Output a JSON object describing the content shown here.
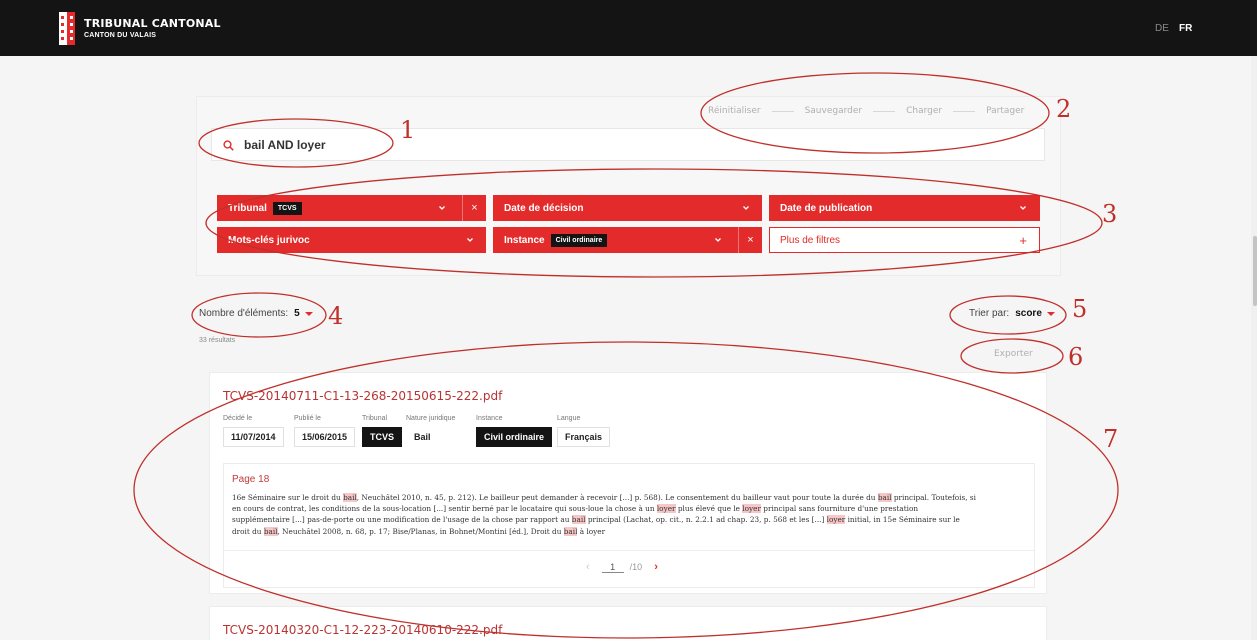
{
  "header": {
    "title": "TRIBUNAL CANTONAL",
    "subtitle": "CANTON DU VALAIS",
    "languages": [
      {
        "code": "DE",
        "active": false
      },
      {
        "code": "FR",
        "active": true
      }
    ]
  },
  "toolbar": {
    "reset_label": "Réinitialiser",
    "save_label": "Sauvegarder",
    "load_label": "Charger",
    "share_label": "Partager"
  },
  "search": {
    "value": "bail AND loyer",
    "icon": "search-icon"
  },
  "filters": {
    "tribunal": {
      "label": "Tribunal",
      "badge": "TCVS"
    },
    "decision_date": {
      "label": "Date de décision"
    },
    "publication_date": {
      "label": "Date de publication"
    },
    "keywords": {
      "label": "Mots-clés jurivoc"
    },
    "instance": {
      "label": "Instance",
      "badge": "Civil ordinaire"
    },
    "more": {
      "label": "Plus de filtres",
      "icon": "+"
    },
    "clear_symbol": "×"
  },
  "results": {
    "page_size_label": "Nombre d'éléments:",
    "page_size": "5",
    "total": "33 résultats",
    "sort_label": "Trier par:",
    "sort_value": "score",
    "export_label": "Exporter",
    "items": [
      {
        "title": "TCVS-20140711-C1-13-268-20150615-222.pdf",
        "meta": {
          "decided_label": "Décidé le",
          "decided": "11/07/2014",
          "published_label": "Publié le",
          "published": "15/06/2015",
          "tribunal_label": "Tribunal",
          "tribunal": "TCVS",
          "nature_label": "Nature juridique",
          "nature": "Bail",
          "instance_label": "Instance",
          "instance": "Civil ordinaire",
          "language_label": "Langue",
          "language": "Français"
        },
        "excerpt": {
          "page": "Page 18",
          "lines": [
            [
              {
                "t": "16e Séminaire sur le droit du "
              },
              {
                "t": "bail",
                "hl": true
              },
              {
                "t": ", Neuchâtel 2010, n. 45, p. 212). Le bailleur peut demander à recevoir [...] p. 568). Le consentement du bailleur vaut pour toute la durée du "
              },
              {
                "t": "bail",
                "hl": true
              },
              {
                "t": " principal. Toutefois, si"
              }
            ],
            [
              {
                "t": "en cours de contrat, les conditions de la sous-location [...] sentir berné par le locataire qui sous-loue la chose à un "
              },
              {
                "t": "loyer",
                "hl": true
              },
              {
                "t": " plus élevé que le "
              },
              {
                "t": "loyer",
                "hl": true
              },
              {
                "t": " principal sans fourniture d'une prestation"
              }
            ],
            [
              {
                "t": "supplémentaire [...] pas-de-porte ou une modification de l'usage de la chose par rapport au "
              },
              {
                "t": "bail",
                "hl": true
              },
              {
                "t": " principal (Lachat, op. cit., n. 2.2.1 ad chap. 23, p. 568 et les [...] "
              },
              {
                "t": "loyer",
                "hl": true
              },
              {
                "t": " initial, in 15e Séminaire sur le"
              }
            ],
            [
              {
                "t": "droit du "
              },
              {
                "t": "bail",
                "hl": true
              },
              {
                "t": ", Neuchâtel 2008, n. 68, p. 17; Bise/Planas, in Bohnet/Montini [éd.], Droit du "
              },
              {
                "t": "bail",
                "hl": true
              },
              {
                "t": " à loyer"
              }
            ]
          ]
        },
        "pager": {
          "prev": "‹",
          "current": "1",
          "total": "/10",
          "next": "›"
        }
      },
      {
        "title": "TCVS-20140320-C1-12-223-20140610-222.pdf"
      }
    ]
  },
  "annotations": [
    "1",
    "2",
    "3",
    "4",
    "5",
    "6",
    "7"
  ],
  "colors": {
    "accent": "#e32b2b",
    "topbar": "#141414",
    "annotation": "#c0302b",
    "highlight": "#f7c7c7",
    "title_red": "#b93333"
  }
}
